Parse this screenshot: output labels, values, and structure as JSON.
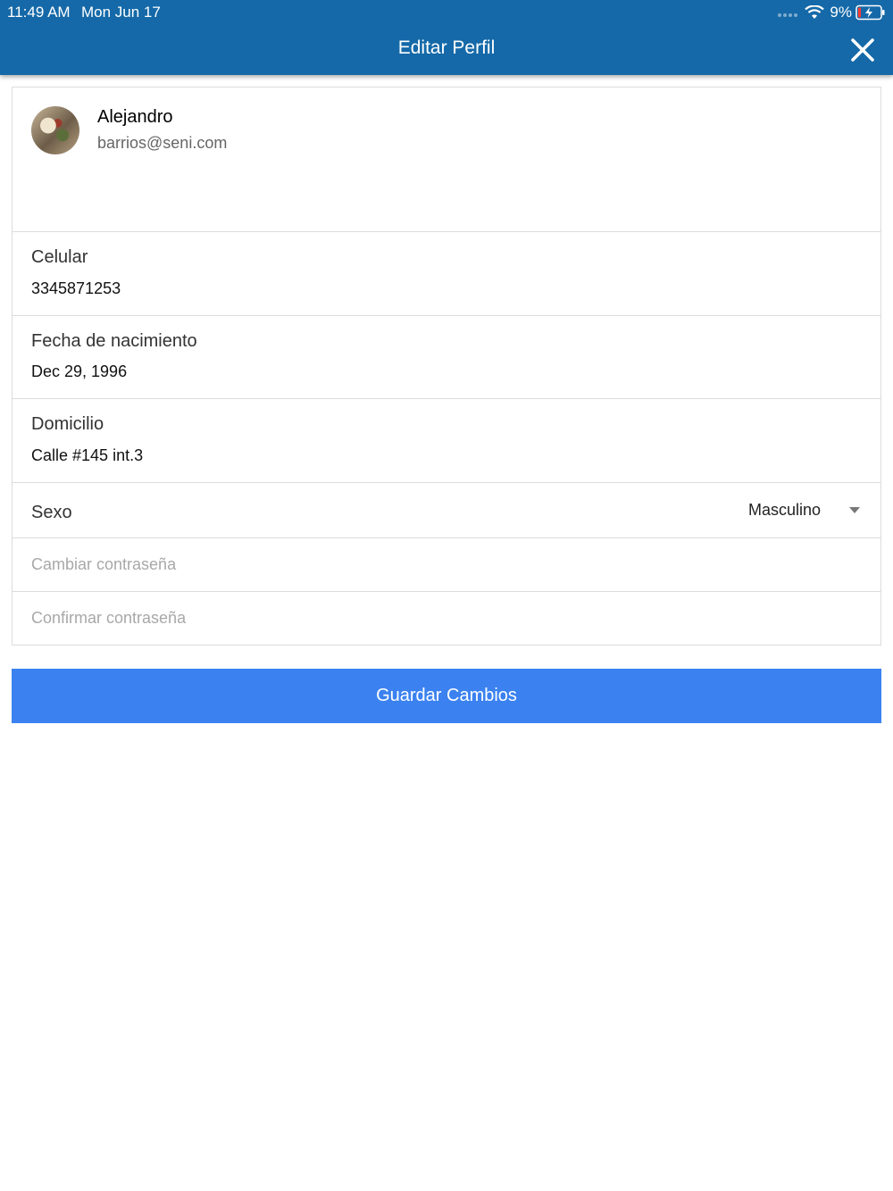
{
  "status_bar": {
    "time": "11:49 AM",
    "date": "Mon Jun 17",
    "battery": "9%",
    "wifi_icon": "wifi-icon",
    "battery_icon": "battery-charging-icon"
  },
  "header": {
    "title": "Editar Perfil",
    "close_icon": "close-icon",
    "background_color": "#1569a8"
  },
  "profile": {
    "name": "Alejandro",
    "email": "barrios@seni.com"
  },
  "fields": {
    "celular": {
      "label": "Celular",
      "value": "3345871253"
    },
    "fecha": {
      "label": "Fecha de nacimiento",
      "value": "Dec 29, 1996"
    },
    "domicilio": {
      "label": "Domicilio",
      "value": "Calle #145 int.3"
    },
    "sexo": {
      "label": "Sexo",
      "value": "Masculino"
    }
  },
  "password": {
    "change_placeholder": "Cambiar contraseña",
    "confirm_placeholder": "Confirmar contraseña"
  },
  "actions": {
    "save_label": "Guardar Cambios",
    "save_color": "#3b82f0"
  }
}
